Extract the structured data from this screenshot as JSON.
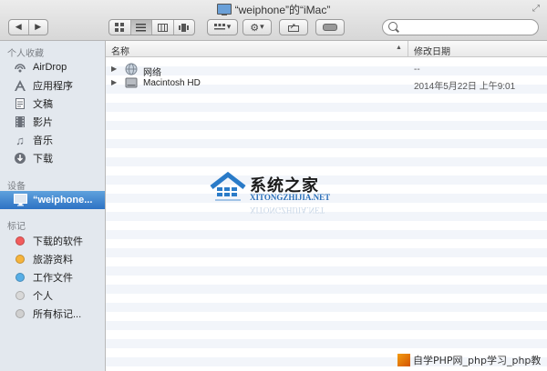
{
  "window": {
    "title": "“weiphone”的“iMac”"
  },
  "toolbar": {
    "back_icon": "chevron-left-icon",
    "forward_icon": "chevron-right-icon",
    "view_modes": [
      "icon-view-icon",
      "list-view-icon",
      "column-view-icon",
      "coverflow-view-icon"
    ],
    "active_view": "list-view-icon",
    "search_placeholder": ""
  },
  "sidebar": {
    "favorites_header": "个人收藏",
    "favorites": [
      {
        "label": "AirDrop",
        "icon": "airdrop-icon"
      },
      {
        "label": "应用程序",
        "icon": "applications-icon"
      },
      {
        "label": "文稿",
        "icon": "documents-icon"
      },
      {
        "label": "影片",
        "icon": "movies-icon"
      },
      {
        "label": "音乐",
        "icon": "music-icon"
      },
      {
        "label": "下载",
        "icon": "downloads-icon"
      }
    ],
    "devices_header": "设备",
    "devices": [
      {
        "label": "“weiphone...",
        "icon": "imac-icon",
        "selected": true
      }
    ],
    "tags_header": "标记",
    "tags": [
      {
        "label": "下载的软件",
        "color": "#f25c5c"
      },
      {
        "label": "旅游资料",
        "color": "#f6b43c"
      },
      {
        "label": "工作文件",
        "color": "#57aee6"
      },
      {
        "label": "个人",
        "color": "#d8d8d8"
      },
      {
        "label": "所有标记...",
        "color": "#d0d0d0"
      }
    ]
  },
  "list": {
    "col_name": "名称",
    "col_modified": "修改日期",
    "rows": [
      {
        "name": "网络",
        "date": "--",
        "icon": "network-globe-icon"
      },
      {
        "name": "Macintosh HD",
        "date": "2014年5月22日 上午9:01",
        "icon": "hard-drive-icon"
      }
    ]
  },
  "watermark": {
    "brand": "系统之家",
    "url": "XITONGZHIJIA.NET",
    "footer": "自学PHP网_php学习_php教"
  },
  "colors": {
    "selection": "#3a7fcc",
    "sidebar_bg": "#e3e8ee",
    "stripe": "#f2f5fa"
  }
}
